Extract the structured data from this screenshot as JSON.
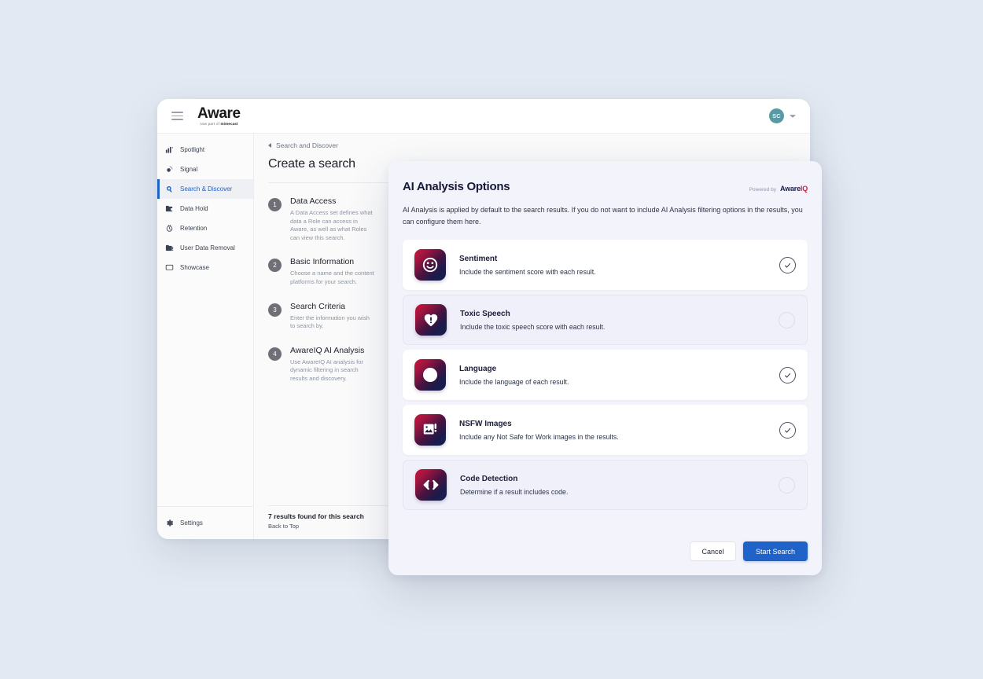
{
  "topbar": {
    "menu_icon": "hamburger-icon",
    "brand_name": "Aware",
    "brand_sub_prefix": "now part of ",
    "brand_sub_company": "mimecast",
    "avatar_initials": "SC",
    "avatar_color": "#589aa4",
    "caret_icon": "chevron-down-icon"
  },
  "sidebar": {
    "items": [
      {
        "label": "Spotlight",
        "icon": "bar-chart-icon",
        "active": false
      },
      {
        "label": "Signal",
        "icon": "signal-pulse-icon",
        "active": false
      },
      {
        "label": "Search & Discover",
        "icon": "search-magnifier-icon",
        "active": true
      },
      {
        "label": "Data Hold",
        "icon": "folder-lock-icon",
        "active": false
      },
      {
        "label": "Retention",
        "icon": "clock-retention-icon",
        "active": false
      },
      {
        "label": "User Data Removal",
        "icon": "folder-user-icon",
        "active": false
      },
      {
        "label": "Showcase",
        "icon": "monitor-icon",
        "active": false
      }
    ],
    "settings": {
      "label": "Settings",
      "icon": "gear-icon"
    },
    "active_color": "#1f62c8"
  },
  "main": {
    "breadcrumb": "Search and Discover",
    "breadcrumb_icon": "chevron-left-icon",
    "page_title": "Create a search",
    "steps": [
      {
        "num": "1",
        "title": "Data Access",
        "desc": "A Data Access set defines what data a Role can access in Aware, as well as what Roles can view this search."
      },
      {
        "num": "2",
        "title": "Basic Information",
        "desc": "Choose a name and the content platforms for your search."
      },
      {
        "num": "3",
        "title": "Search Criteria",
        "desc": "Enter the information you wish to search by."
      },
      {
        "num": "4",
        "title": "AwareIQ AI Analysis",
        "desc": "Use AwareIQ AI analysis for dynamic filtering in search results and discovery."
      }
    ],
    "results_count": "7 results found for this search",
    "back_to_top": "Back to Top"
  },
  "modal": {
    "title": "AI Analysis Options",
    "powered_by_label": "Powered by",
    "powered_by_brand_1": "Aware",
    "powered_by_brand_2": "IQ",
    "description": "AI Analysis is applied by default to the search results. If you do not want to include AI Analysis filtering options in the results, you can configure them here.",
    "options": [
      {
        "name": "Sentiment",
        "desc": "Include the sentiment score with each result.",
        "icon": "smiley-face-icon",
        "checked": true
      },
      {
        "name": "Toxic Speech",
        "desc": "Include the toxic speech score with each result.",
        "icon": "heart-alert-icon",
        "checked": false
      },
      {
        "name": "Language",
        "desc": "Include the language of each result.",
        "icon": "globe-icon",
        "checked": true
      },
      {
        "name": "NSFW Images",
        "desc": "Include any Not Safe for Work images in the results.",
        "icon": "image-alert-icon",
        "checked": true
      },
      {
        "name": "Code Detection",
        "desc": "Determine if a result includes code.",
        "icon": "code-brackets-icon",
        "checked": false
      }
    ],
    "cancel_label": "Cancel",
    "start_label": "Start Search",
    "primary_color": "#1f62c8",
    "accent_color": "#cf1f3d"
  }
}
